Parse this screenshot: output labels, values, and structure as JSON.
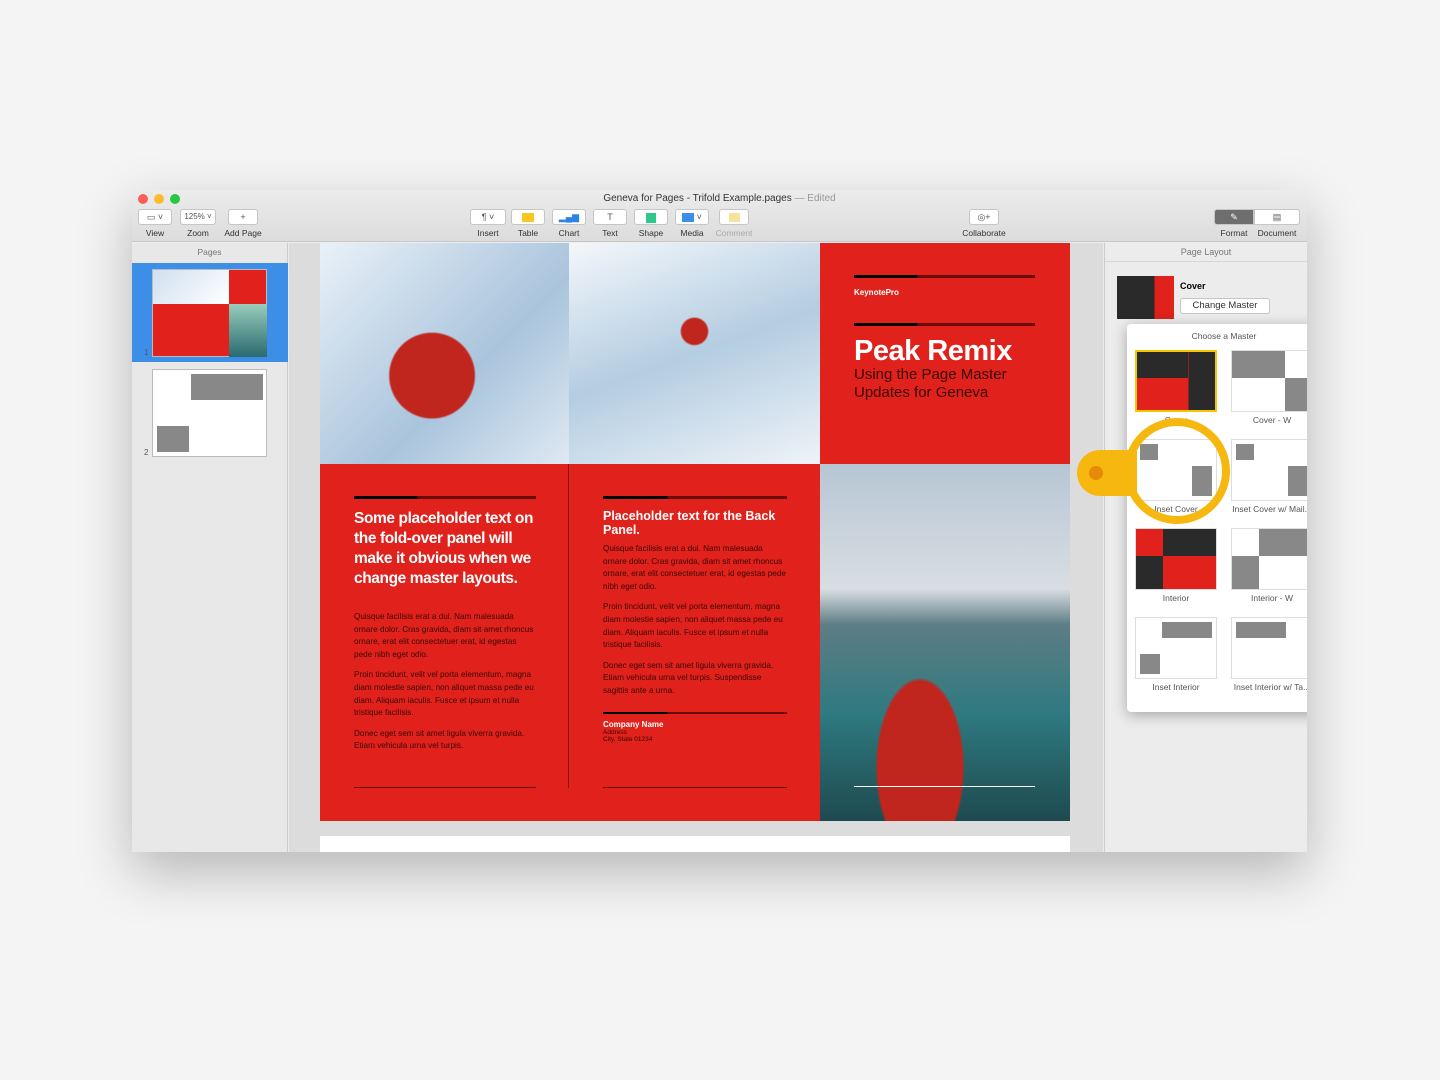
{
  "window": {
    "title": "Geneva for Pages - Trifold Example.pages",
    "edited": "— Edited"
  },
  "toolbar": {
    "view": "View",
    "zoom_value": "125%",
    "zoom": "Zoom",
    "add_page": "Add Page",
    "insert": "Insert",
    "table": "Table",
    "chart": "Chart",
    "text": "Text",
    "shape": "Shape",
    "media": "Media",
    "comment": "Comment",
    "collaborate": "Collaborate",
    "format": "Format",
    "document": "Document"
  },
  "sidebar": {
    "header": "Pages",
    "pages": [
      "1",
      "2"
    ]
  },
  "doc": {
    "brand": "KeynotePro",
    "title": "Peak Remix",
    "subtitle": "Using the Page Master Updates for Geneva",
    "fold_heading": "Some placeholder text on the fold-over panel will make it obvious when we change master layouts.",
    "fold_body": [
      "Quisque facilisis erat a dui. Nam malesuada ornare dolor. Cras gravida, diam sit amet rhoncus ornare, erat elit consectetuer erat, id egestas pede nibh eget odio.",
      "Proin tincidunt, velit vel porta elementum, magna diam molestie sapien, non aliquet massa pede eu diam. Aliquam iaculis. Fusce et ipsum et nulla tristique facilisis.",
      "Donec eget sem sit amet ligula viverra gravida. Etiam vehicula urna vel turpis."
    ],
    "back_heading": "Placeholder text for the Back Panel.",
    "back_body": [
      "Quisque facilisis erat a dui. Nam malesuada ornare dolor. Cras gravida, diam sit amet rhoncus ornare, erat elit consectetuer erat, id egestas pede nibh eget odio.",
      "Proin tincidunt, velit vel porta elementum, magna diam molestie sapien, non aliquet massa pede eu diam. Aliquam iaculis. Fusce et ipsum et nulla tristique facilisis.",
      "Donec eget sem sit amet ligula viverra gravida. Etiam vehicula urna vel turpis. Suspendisse sagittis ante a urna."
    ],
    "company": "Company Name",
    "address": "Address",
    "city": "City, State 01234"
  },
  "inspector": {
    "header": "Page Layout",
    "master_name": "Cover",
    "change_master": "Change Master",
    "popover": {
      "title": "Choose a Master",
      "masters": [
        "Cover",
        "Cover - W",
        "Inset Cover",
        "Inset Cover w/ Mail...",
        "Interior",
        "Interior - W",
        "Inset Interior",
        "Inset Interior w/ Ta..."
      ],
      "selected": "Cover",
      "highlighted": "Inset Cover"
    }
  },
  "colors": {
    "brand_red": "#e1211b",
    "highlight": "#f6b80f",
    "selection": "#3d8ee6"
  }
}
